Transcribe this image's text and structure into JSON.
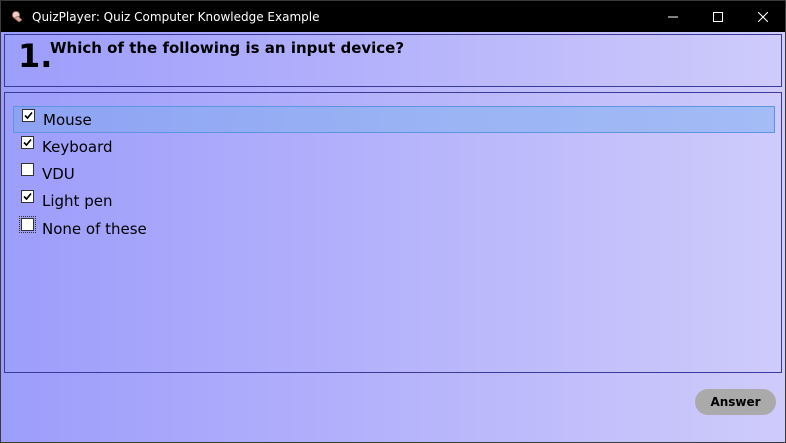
{
  "window": {
    "title": "QuizPlayer: Quiz Computer Knowledge Example",
    "app_icon": "quizplayer-icon",
    "controls": [
      "minimize-icon",
      "maximize-icon",
      "close-icon"
    ]
  },
  "question": {
    "number": "1.",
    "text": "Which of the following is an input device?"
  },
  "options": [
    {
      "label": "Mouse",
      "checked": true,
      "highlighted": true
    },
    {
      "label": "Keyboard",
      "checked": true
    },
    {
      "label": "VDU",
      "checked": false
    },
    {
      "label": "Light pen",
      "checked": true
    },
    {
      "label": "None of these",
      "checked": false,
      "focused": true
    }
  ],
  "actions": {
    "answer_label": "Answer"
  },
  "colors": {
    "title_bar": "#000000",
    "background_start": "#9d9dfb",
    "background_end": "#cfcbfb",
    "selected_row": "#98b2f4",
    "answer_button": "#aaaaaa"
  }
}
